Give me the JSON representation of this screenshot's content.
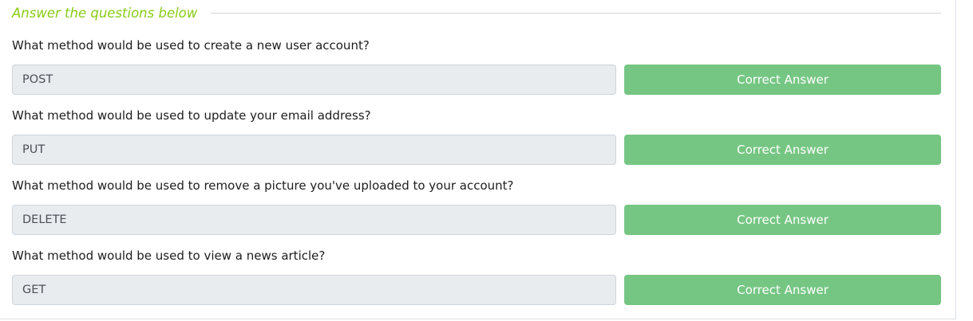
{
  "header": {
    "title": "Answer the questions below"
  },
  "tasks": [
    {
      "question": "What method would be used to create a new user account?",
      "answer": "POST",
      "button_label": "Correct Answer"
    },
    {
      "question": "What method would be used to update your email address?",
      "answer": "PUT",
      "button_label": "Correct Answer"
    },
    {
      "question": "What method would be used to remove a picture you've uploaded to your account?",
      "answer": "DELETE",
      "button_label": "Correct Answer"
    },
    {
      "question": "What method would be used to view a news article?",
      "answer": "GET",
      "button_label": "Correct Answer"
    }
  ],
  "colors": {
    "header_accent": "#88cc14",
    "button_success": "#75c683",
    "input_disabled_bg": "#e9ecef"
  }
}
